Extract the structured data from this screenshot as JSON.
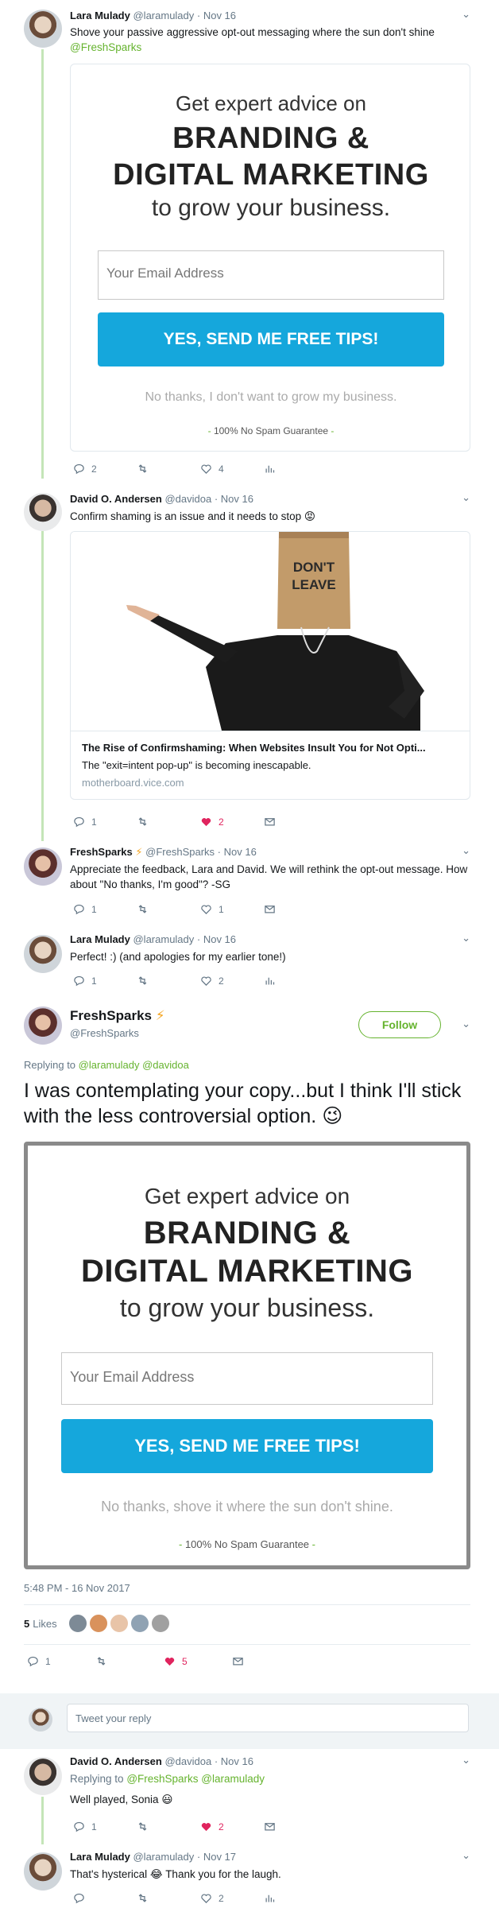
{
  "tweet1": {
    "name": "Lara Mulady",
    "handle": "@laramulady",
    "date": "· Nov 16",
    "text": "Shove your passive aggressive opt-out messaging where the sun don't shine",
    "mention": "@FreshSparks",
    "card": {
      "line1": "Get expert advice on",
      "line2": "BRANDING &",
      "line3": "DIGITAL MARKETING",
      "line4": "to grow your business.",
      "email_placeholder": "Your Email Address",
      "cta": "YES, SEND ME FREE TIPS!",
      "no_thanks": "No thanks, I don't want to grow my business.",
      "spam_dash1": "-",
      "spam": "100% No Spam Guarantee",
      "spam_dash2": "-"
    },
    "replies": "2",
    "retweets": "",
    "likes": "4"
  },
  "tweet2": {
    "name": "David O. Andersen",
    "handle": "@davidoa",
    "date": "· Nov 16",
    "text": "Confirm shaming is an issue and it needs to stop",
    "emoji": "😡",
    "card": {
      "bag_text": "DON'T LEAVE",
      "title": "The Rise of Confirmshaming: When Websites Insult You for Not Opti...",
      "desc": "The \"exit=intent pop-up\" is becoming inescapable.",
      "domain": "motherboard.vice.com"
    },
    "replies": "1",
    "likes": "2"
  },
  "tweet3": {
    "name": "FreshSparks",
    "bolt": "⚡",
    "handle": "@FreshSparks",
    "date": "· Nov 16",
    "text": "Appreciate the feedback, Lara and David. We will rethink the opt-out message. How about \"No thanks, I'm good\"? -SG",
    "replies": "1",
    "likes": "1"
  },
  "tweet4": {
    "name": "Lara Mulady",
    "handle": "@laramulady",
    "date": "· Nov 16",
    "text": "Perfect! :) (and apologies for my earlier tone!)",
    "replies": "1",
    "likes": "2"
  },
  "main": {
    "name": "FreshSparks",
    "bolt": "⚡",
    "handle": "@FreshSparks",
    "follow": "Follow",
    "replying_prefix": "Replying to",
    "replying_to": "@laramulady @davidoa",
    "text": "I was contemplating your copy...but I think I'll stick with the less controversial option.",
    "emoji": "😉",
    "card": {
      "line1": "Get expert advice on",
      "line2": "BRANDING &",
      "line3": "DIGITAL MARKETING",
      "line4": "to grow your business.",
      "email_placeholder": "Your Email Address",
      "cta": "YES, SEND ME FREE TIPS!",
      "no_thanks": "No thanks, shove it where the sun don't shine.",
      "spam_dash1": "-",
      "spam": "100% No Spam Guarantee",
      "spam_dash2": "-"
    },
    "timestamp": "5:48 PM - 16 Nov 2017",
    "likes_count": "5",
    "likes_label": "Likes",
    "replies": "1",
    "likes": "5"
  },
  "reply_placeholder": "Tweet your reply",
  "tweet5": {
    "name": "David O. Andersen",
    "handle": "@davidoa",
    "date": "· Nov 16",
    "replying_prefix": "Replying to",
    "replying_to": "@FreshSparks @laramulady",
    "text": "Well played, Sonia",
    "emoji": "😃",
    "replies": "1",
    "likes": "2"
  },
  "tweet6": {
    "name": "Lara Mulady",
    "handle": "@laramulady",
    "date": "· Nov 17",
    "text_a": "That's hysterical",
    "emoji": "😂",
    "text_b": "Thank you for the laugh.",
    "likes": "2"
  },
  "colors": {
    "accent": "#65b32e",
    "like": "#e0245e",
    "cta": "#15a7dc",
    "thread": "#c4e5b8"
  }
}
